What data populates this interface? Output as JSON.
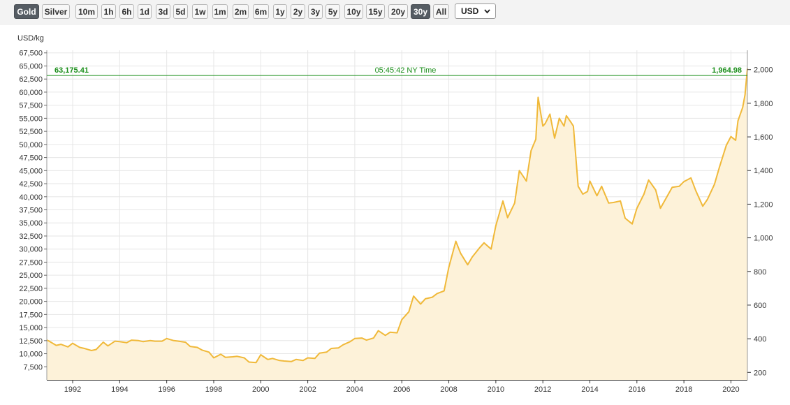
{
  "toolbar": {
    "metals": [
      {
        "label": "Gold",
        "active": true
      },
      {
        "label": "Silver",
        "active": false
      }
    ],
    "ranges": [
      {
        "label": "10m",
        "active": false
      },
      {
        "label": "1h",
        "active": false
      },
      {
        "label": "6h",
        "active": false
      },
      {
        "label": "1d",
        "active": false
      },
      {
        "label": "3d",
        "active": false
      },
      {
        "label": "5d",
        "active": false
      },
      {
        "label": "1w",
        "active": false
      },
      {
        "label": "1m",
        "active": false
      },
      {
        "label": "2m",
        "active": false
      },
      {
        "label": "6m",
        "active": false
      },
      {
        "label": "1y",
        "active": false
      },
      {
        "label": "2y",
        "active": false
      },
      {
        "label": "3y",
        "active": false
      },
      {
        "label": "5y",
        "active": false
      },
      {
        "label": "10y",
        "active": false
      },
      {
        "label": "15y",
        "active": false
      },
      {
        "label": "20y",
        "active": false
      },
      {
        "label": "30y",
        "active": true
      },
      {
        "label": "All",
        "active": false
      }
    ],
    "currency": {
      "value": "USD",
      "icon": "chevron-down-icon"
    }
  },
  "colors": {
    "line": "#f0b93a",
    "area": "#fdf2d9",
    "current": "#1a8e1a"
  },
  "chart_data": {
    "type": "area",
    "unit_label": "USD/kg",
    "current_left": "63,175.41",
    "current_right": "1,964.98",
    "timestamp": "05:45:42 NY Time",
    "current_value_kg": 63175.41,
    "grid": true,
    "xlim": [
      1990.9,
      2020.7
    ],
    "x_ticks": [
      1992,
      1994,
      1996,
      1998,
      2000,
      2002,
      2004,
      2006,
      2008,
      2010,
      2012,
      2014,
      2016,
      2018,
      2020
    ],
    "left_axis": {
      "ylim": [
        5000,
        68000
      ],
      "ticks": [
        7500,
        10000,
        12500,
        15000,
        17500,
        20000,
        22500,
        25000,
        27500,
        30000,
        32500,
        35000,
        37500,
        40000,
        42500,
        45000,
        47500,
        50000,
        52500,
        55000,
        57500,
        60000,
        62500,
        65000,
        67500
      ],
      "tick_labels": [
        "7,500",
        "10,000",
        "12,500",
        "15,000",
        "17,500",
        "20,000",
        "22,500",
        "25,000",
        "27,500",
        "30,000",
        "32,500",
        "35,000",
        "37,500",
        "40,000",
        "42,500",
        "45,000",
        "47,500",
        "50,000",
        "52,500",
        "55,000",
        "57,500",
        "60,000",
        "62,500",
        "65,000",
        "67,500"
      ]
    },
    "right_axis": {
      "ticks": [
        200,
        400,
        600,
        800,
        1000,
        1200,
        1400,
        1600,
        1800,
        2000
      ],
      "tick_labels": [
        "200",
        "400",
        "600",
        "800",
        "1,000",
        "1,200",
        "1,400",
        "1,600",
        "1,800",
        "2,000"
      ],
      "kg_per_unit": 32.1507
    },
    "series": [
      {
        "x": [
          1990.9,
          1991.0,
          1991.3,
          1991.5,
          1991.8,
          1992.0,
          1992.3,
          1992.5,
          1992.8,
          1993.0,
          1993.3,
          1993.5,
          1993.8,
          1994.0,
          1994.3,
          1994.5,
          1994.8,
          1995.0,
          1995.3,
          1995.5,
          1995.8,
          1996.0,
          1996.3,
          1996.5,
          1996.8,
          1997.0,
          1997.3,
          1997.5,
          1997.8,
          1998.0,
          1998.3,
          1998.5,
          1998.8,
          1999.0,
          1999.3,
          1999.5,
          1999.8,
          2000.0,
          2000.3,
          2000.5,
          2000.8,
          2001.0,
          2001.3,
          2001.5,
          2001.8,
          2002.0,
          2002.3,
          2002.5,
          2002.8,
          2003.0,
          2003.3,
          2003.5,
          2003.8,
          2004.0,
          2004.3,
          2004.5,
          2004.8,
          2005.0,
          2005.3,
          2005.5,
          2005.8,
          2006.0,
          2006.3,
          2006.5,
          2006.8,
          2007.0,
          2007.3,
          2007.5,
          2007.8,
          2008.0,
          2008.3,
          2008.5,
          2008.8,
          2009.0,
          2009.3,
          2009.5,
          2009.8,
          2010.0,
          2010.3,
          2010.5,
          2010.8,
          2011.0,
          2011.3,
          2011.5,
          2011.7,
          2011.8,
          2012.0,
          2012.1,
          2012.3,
          2012.5,
          2012.7,
          2012.9,
          2013.0,
          2013.2,
          2013.3,
          2013.5,
          2013.7,
          2013.9,
          2014.0,
          2014.3,
          2014.5,
          2014.8,
          2015.0,
          2015.3,
          2015.5,
          2015.8,
          2016.0,
          2016.3,
          2016.5,
          2016.8,
          2017.0,
          2017.3,
          2017.5,
          2017.8,
          2018.0,
          2018.3,
          2018.5,
          2018.8,
          2019.0,
          2019.3,
          2019.5,
          2019.8,
          2020.0,
          2020.2,
          2020.3,
          2020.5,
          2020.6,
          2020.7
        ],
        "values": [
          12600,
          12400,
          11600,
          11800,
          11300,
          12000,
          11200,
          11000,
          10600,
          10800,
          12200,
          11500,
          12400,
          12300,
          12100,
          12600,
          12500,
          12300,
          12500,
          12400,
          12400,
          12900,
          12500,
          12400,
          12200,
          11400,
          11200,
          10700,
          10300,
          9200,
          9900,
          9300,
          9400,
          9500,
          9200,
          8400,
          8300,
          9800,
          8900,
          9100,
          8700,
          8600,
          8500,
          8900,
          8700,
          9200,
          9100,
          10100,
          10300,
          11000,
          11100,
          11700,
          12300,
          12900,
          13000,
          12600,
          13000,
          14400,
          13500,
          14100,
          14000,
          16500,
          18000,
          21000,
          19500,
          20500,
          20800,
          21500,
          22000,
          26500,
          31500,
          29200,
          27000,
          28500,
          30200,
          31200,
          30000,
          34500,
          39200,
          36000,
          38800,
          45000,
          43000,
          48800,
          51000,
          59000,
          53500,
          54000,
          55800,
          51200,
          55000,
          53500,
          55500,
          54200,
          53500,
          42000,
          40500,
          41000,
          43000,
          40200,
          42000,
          38800,
          38900,
          39200,
          35900,
          34800,
          37800,
          40500,
          43200,
          41300,
          37800,
          40200,
          41800,
          42000,
          42900,
          43600,
          41200,
          38200,
          39500,
          42400,
          45500,
          49800,
          51500,
          50800,
          54500,
          57100,
          59500,
          64500
        ]
      }
    ]
  }
}
